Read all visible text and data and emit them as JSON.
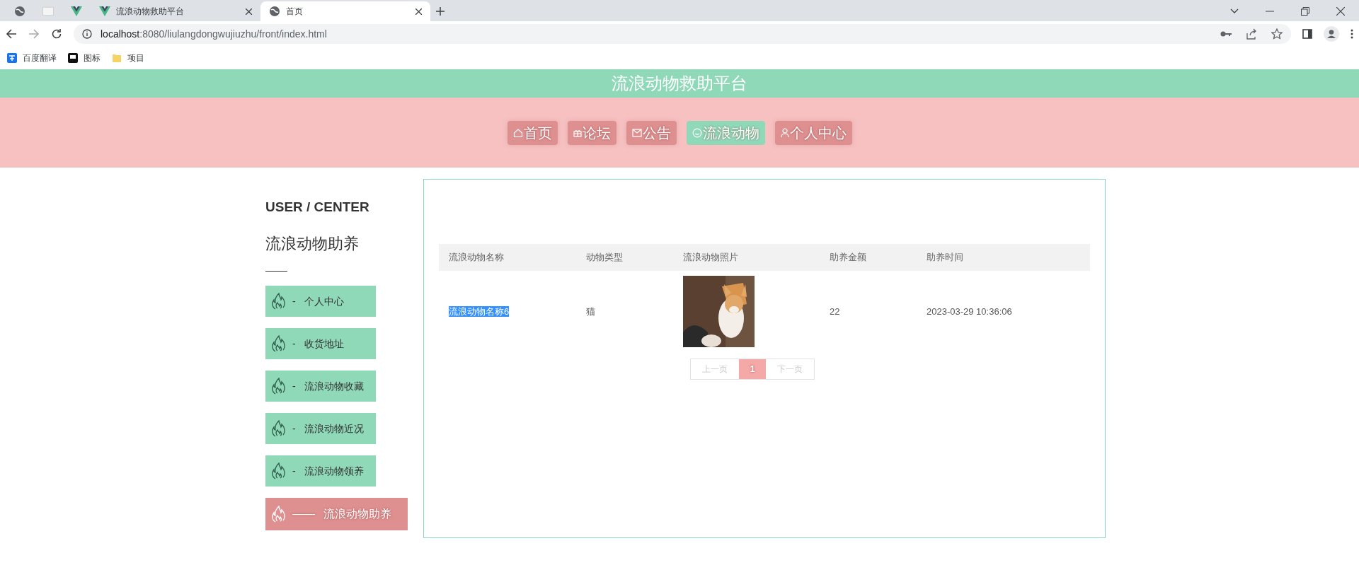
{
  "browser": {
    "tabs": [
      {
        "kind": "globe",
        "selected": false
      },
      {
        "kind": "blank",
        "selected": false
      },
      {
        "kind": "vue",
        "selected": false
      },
      {
        "kind": "vue",
        "label": "流浪动物救助平台",
        "selected": false
      },
      {
        "kind": "globe",
        "label": "首页",
        "selected": true
      }
    ],
    "url_host": "localhost",
    "url_rest": ":8080/liulangdongwujiuzhu/front/index.html",
    "bookmarks": [
      {
        "kind": "translate",
        "label": "百度翻译"
      },
      {
        "kind": "flag",
        "label": "图标"
      },
      {
        "kind": "folder",
        "label": "项目"
      }
    ]
  },
  "site_title": "流浪动物救助平台",
  "nav": [
    {
      "kind": "home",
      "label": "首页",
      "selected": false
    },
    {
      "kind": "gift",
      "label": "论坛",
      "selected": false
    },
    {
      "kind": "mail",
      "label": "公告",
      "selected": false
    },
    {
      "kind": "smile",
      "label": "流浪动物",
      "selected": true
    },
    {
      "kind": "user",
      "label": "个人中心",
      "selected": false
    }
  ],
  "sidebar": {
    "heading": "USER / CENTER",
    "subtitle": "流浪动物助养",
    "items": [
      {
        "dash": "-",
        "label": "个人中心",
        "selected": false
      },
      {
        "dash": "-",
        "label": "收货地址",
        "selected": false
      },
      {
        "dash": "-",
        "label": "流浪动物收藏",
        "selected": false
      },
      {
        "dash": "-",
        "label": "流浪动物近况",
        "selected": false
      },
      {
        "dash": "-",
        "label": "流浪动物领养",
        "selected": false
      },
      {
        "dash": "——",
        "label": "流浪动物助养",
        "selected": true
      }
    ]
  },
  "table": {
    "columns": [
      "流浪动物名称",
      "动物类型",
      "流浪动物照片",
      "助养金额",
      "助养时间"
    ],
    "rows": [
      {
        "name": "流浪动物名称6",
        "name_highlighted": true,
        "type": "猫",
        "amount": "22",
        "time": "2023-03-29 10:36:06"
      }
    ]
  },
  "pagination": {
    "prev": "上一页",
    "pages": [
      {
        "label": "1",
        "selected": true
      }
    ],
    "next": "下一页"
  }
}
